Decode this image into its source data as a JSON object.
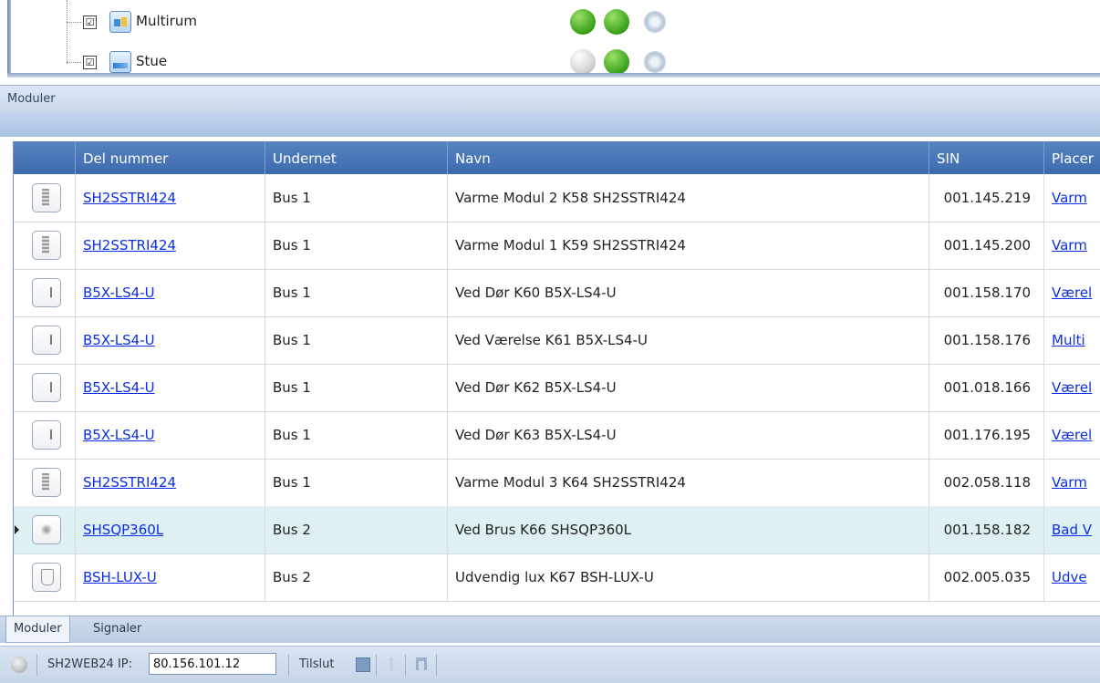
{
  "tree": {
    "items": [
      {
        "label": "Multirum",
        "checked": "☑",
        "icon": "multirum-room-icon",
        "status": [
          "green",
          "green",
          "disabled"
        ]
      },
      {
        "label": "Stue",
        "checked": "☑",
        "icon": "stue-room-icon",
        "status": [
          "gray",
          "green",
          "disabled"
        ]
      }
    ]
  },
  "section": {
    "title": "Moduler"
  },
  "grid": {
    "columns": [
      "Del nummer",
      "Undernet",
      "Navn",
      "SIN",
      "Placer"
    ],
    "rows": [
      {
        "icon": "stri",
        "part": "SH2SSTRI424",
        "subnet": "Bus 1",
        "name": "Varme Modul 2 K58 SH2SSTRI424",
        "sin": "001.145.219",
        "place": "Varm",
        "selected": false
      },
      {
        "icon": "stri",
        "part": "SH2SSTRI424",
        "subnet": "Bus 1",
        "name": "Varme Modul 1 K59 SH2SSTRI424",
        "sin": "001.145.200",
        "place": "Varm",
        "selected": false
      },
      {
        "icon": "ls4",
        "part": "B5X-LS4-U",
        "subnet": "Bus 1",
        "name": "Ved Dør K60 B5X-LS4-U",
        "sin": "001.158.170",
        "place": "Værel",
        "selected": false
      },
      {
        "icon": "ls4",
        "part": "B5X-LS4-U",
        "subnet": "Bus 1",
        "name": "Ved Værelse K61 B5X-LS4-U",
        "sin": "001.158.176",
        "place": "Multi",
        "selected": false
      },
      {
        "icon": "ls4",
        "part": "B5X-LS4-U",
        "subnet": "Bus 1",
        "name": "Ved Dør  K62 B5X-LS4-U",
        "sin": "001.018.166",
        "place": "Værel",
        "selected": false
      },
      {
        "icon": "ls4",
        "part": "B5X-LS4-U",
        "subnet": "Bus 1",
        "name": "Ved Dør K63 B5X-LS4-U",
        "sin": "001.176.195",
        "place": "Værel",
        "selected": false
      },
      {
        "icon": "stri",
        "part": "SH2SSTRI424",
        "subnet": "Bus 1",
        "name": "Varme Modul 3 K64 SH2SSTRI424",
        "sin": "002.058.118",
        "place": "Varm",
        "selected": false
      },
      {
        "icon": "sqp",
        "part": "SHSQP360L",
        "subnet": "Bus 2",
        "name": "Ved Brus K66 SHSQP360L",
        "sin": "001.158.182",
        "place": "Bad V",
        "selected": true
      },
      {
        "icon": "lux",
        "part": "BSH-LUX-U",
        "subnet": "Bus 2",
        "name": "Udvendig lux K67 BSH-LUX-U",
        "sin": "002.005.035",
        "place": "Udve",
        "selected": false
      }
    ]
  },
  "tabs": [
    {
      "label": "Moduler",
      "active": true
    },
    {
      "label": "Signaler",
      "active": false
    }
  ],
  "statusbar": {
    "device_label": "SH2WEB24 IP:",
    "ip_value": "80.156.101.12",
    "connect_label": "Tilslut"
  },
  "colors": {
    "header_blue": "#4a78b8",
    "link_blue": "#0b2ee8",
    "selected_row": "#dff0f3"
  }
}
